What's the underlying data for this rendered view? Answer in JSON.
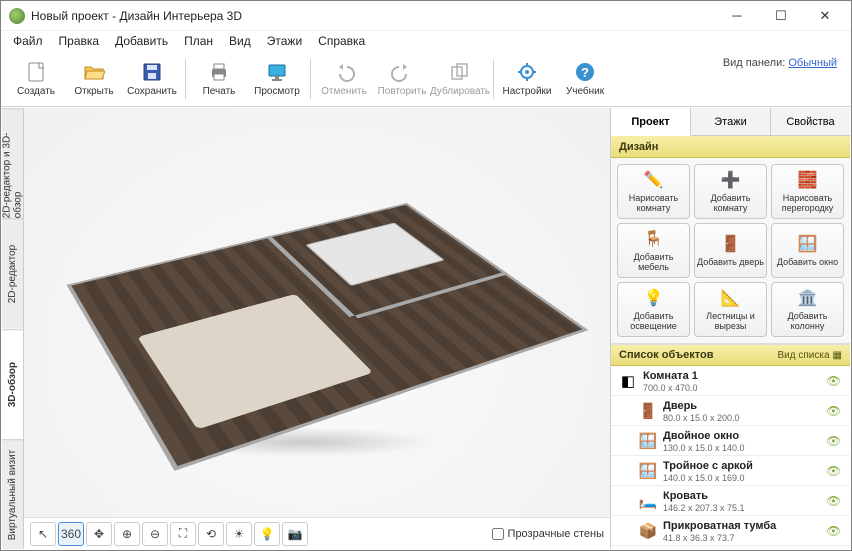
{
  "window": {
    "title": "Новый проект - Дизайн Интерьера 3D"
  },
  "menubar": [
    "Файл",
    "Правка",
    "Добавить",
    "План",
    "Вид",
    "Этажи",
    "Справка"
  ],
  "toolbar": {
    "create": "Создать",
    "open": "Открыть",
    "save": "Сохранить",
    "print": "Печать",
    "preview": "Просмотр",
    "undo": "Отменить",
    "redo": "Повторить",
    "duplicate": "Дублировать",
    "settings": "Настройки",
    "tutorial": "Учебник",
    "panel_mode_label": "Вид панели:",
    "panel_mode_value": "Обычный"
  },
  "vtabs": {
    "combo": "2D-редактор и 3D-обзор",
    "editor2d": "2D-редактор",
    "view3d": "3D-обзор",
    "virtual": "Виртуальный визит"
  },
  "view_tools": {
    "transparent_walls": "Прозрачные стены"
  },
  "panel": {
    "tabs": {
      "project": "Проект",
      "floors": "Этажи",
      "props": "Свойства"
    },
    "design_header": "Дизайн",
    "design": {
      "draw_room": "Нарисовать комнату",
      "add_room": "Добавить комнату",
      "draw_partition": "Нарисовать перегородку",
      "add_furniture": "Добавить мебель",
      "add_door": "Добавить дверь",
      "add_window": "Добавить окно",
      "add_light": "Добавить освещение",
      "stairs": "Лестницы и вырезы",
      "add_column": "Добавить колонну"
    },
    "list_header": "Список объектов",
    "list_mode": "Вид списка",
    "objects": [
      {
        "name": "Комната 1",
        "dim": "700.0 x 470.0",
        "icon": "room"
      },
      {
        "name": "Дверь",
        "dim": "80.0 x 15.0 x 200.0",
        "icon": "door",
        "child": true
      },
      {
        "name": "Двойное окно",
        "dim": "130.0 x 15.0 x 140.0",
        "icon": "window",
        "child": true
      },
      {
        "name": "Тройное с аркой",
        "dim": "140.0 x 15.0 x 169.0",
        "icon": "window",
        "child": true
      },
      {
        "name": "Кровать",
        "dim": "146.2 x 207.3 x 75.1",
        "icon": "bed",
        "child": true
      },
      {
        "name": "Прикроватная тумба",
        "dim": "41.8 x 36.3 x 73.7",
        "icon": "box",
        "child": true
      }
    ]
  }
}
